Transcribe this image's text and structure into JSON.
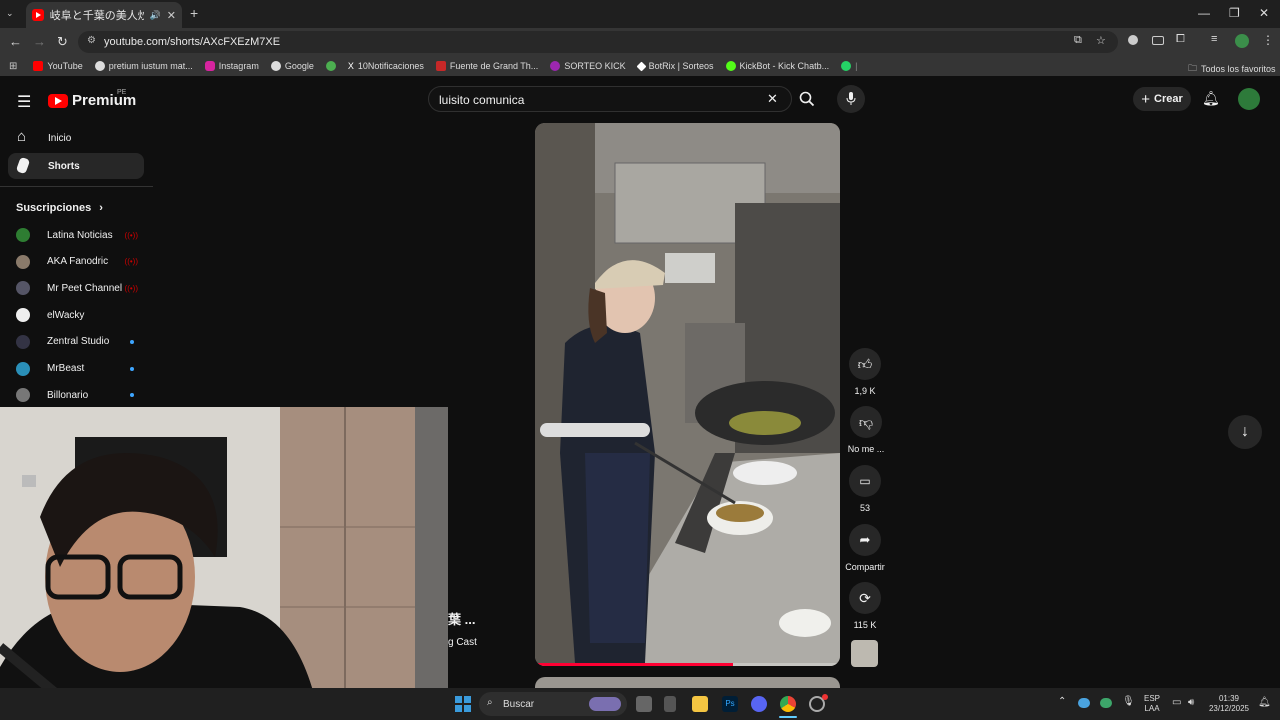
{
  "browser": {
    "tab_title": "岐阜と千葉の美人炒飯職人の",
    "url": "youtube.com/shorts/AXcFXEzM7XE",
    "bookmarks": [
      "YouTube",
      "pretium iustum mat...",
      "Instagram",
      "Google",
      "10Notificaciones",
      "Fuente de Grand Th...",
      "SORTEO KICK",
      "BotRix | Sorteos",
      "KickBot - Kick Chatb..."
    ],
    "all_bookmarks": "Todos los favoritos"
  },
  "youtube": {
    "logo_text": "Premium",
    "logo_region": "PE",
    "search_query": "luisito comunica",
    "create_label": "Crear",
    "nav": {
      "home": "Inicio",
      "shorts": "Shorts"
    },
    "subs_title": "Suscripciones",
    "subs": [
      {
        "name": "Latina Noticias",
        "status": "live",
        "color": "#2e7d32"
      },
      {
        "name": "AKA Fanodric",
        "status": "live",
        "color": "#8a7a6a"
      },
      {
        "name": "Mr Peet Channel",
        "status": "live",
        "color": "#556"
      },
      {
        "name": "elWacky",
        "status": "none",
        "color": "#eee"
      },
      {
        "name": "Zentral Studio",
        "status": "new",
        "color": "#334"
      },
      {
        "name": "MrBeast",
        "status": "new",
        "color": "#2a8fb8"
      },
      {
        "name": "Billonario",
        "status": "new",
        "color": "#777"
      }
    ],
    "actions": {
      "likes": "1,9 K",
      "dislike": "No me ...",
      "comments": "53",
      "share": "Compartir",
      "remix": "115 K"
    },
    "overlay_text": {
      "title": "葉 ...",
      "subtitle": "g Cast"
    },
    "progress": 0.65
  },
  "taskbar": {
    "search": "Buscar",
    "lang": "ESP",
    "lang2": "LAA",
    "time": "01:39",
    "date": "23/12/2025"
  }
}
